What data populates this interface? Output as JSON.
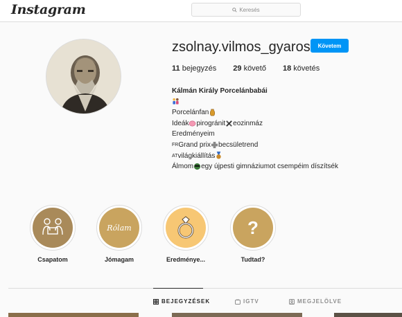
{
  "header": {
    "logo": "Instagram",
    "search_placeholder": "Keresés"
  },
  "profile": {
    "username": "zsolnay.vilmos_gyaros",
    "follow_label": "Követem",
    "stats": [
      {
        "count": "11",
        "label": "bejegyzés"
      },
      {
        "count": "29",
        "label": "követő"
      },
      {
        "count": "18",
        "label": "követés"
      }
    ],
    "bio": {
      "name": "Kálmán Király Porcelánbabái",
      "line_2": "Porcelánfan",
      "line_3a": "Ideák",
      "line_3b": "pirogránit",
      "line_3c": "eozinmáz",
      "line_4": "Eredményeim",
      "line_5_prefix": "FR",
      "line_5a": "Grand prix",
      "line_5b": "becsületrend",
      "line_6_prefix": "AT",
      "line_6a": "világkiállítás",
      "line_7a": "Álmom",
      "line_7b": "egy újpesti gimnáziumot csempéim díszítsék"
    }
  },
  "highlights": [
    {
      "label": "Csapatom"
    },
    {
      "label": "Jómagam",
      "cover_text": "Rólam"
    },
    {
      "label": "Eredménye..."
    },
    {
      "label": "Tudtad?",
      "cover_text": "?"
    }
  ],
  "tabs": [
    {
      "label": "BEJEGYZÉSEK",
      "active": true
    },
    {
      "label": "IGTV",
      "active": false
    },
    {
      "label": "MEGJELÖLVE",
      "active": false
    }
  ],
  "colors": {
    "accent": "#0095f6",
    "highlight_gold": "#c9a45f",
    "highlight_light": "#f7c774"
  }
}
